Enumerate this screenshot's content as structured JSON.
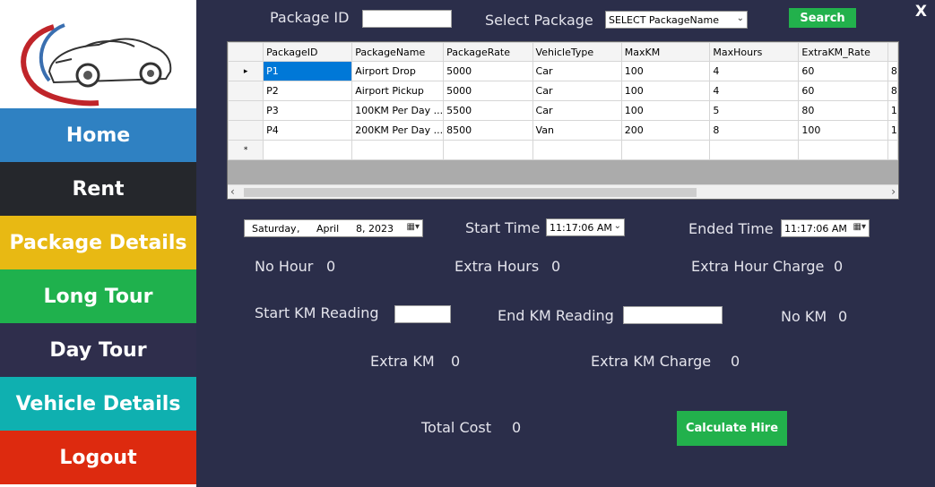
{
  "sidebar": {
    "items": [
      {
        "label": "Home",
        "color": "#2f81c2"
      },
      {
        "label": "Rent",
        "color": "#25272c"
      },
      {
        "label": "Package Details",
        "color": "#e8b913"
      },
      {
        "label": "Long Tour",
        "color": "#1fb14d"
      },
      {
        "label": "Day Tour",
        "color": "#2f2e4c"
      },
      {
        "label": "Vehicle Details",
        "color": "#0fb0b0"
      },
      {
        "label": "Logout",
        "color": "#dd2a0f"
      }
    ]
  },
  "search": {
    "package_id_label": "Package ID",
    "package_id_value": "",
    "select_package_label": "Select Package",
    "select_package_value": "SELECT PackageName",
    "search_button": "Search"
  },
  "grid": {
    "columns": [
      "PackageID",
      "PackageName",
      "PackageRate",
      "VehicleType",
      "MaxKM",
      "MaxHours",
      "ExtraKM_Rate",
      ""
    ],
    "rows": [
      [
        "P1",
        "Airport Drop",
        "5000",
        "Car",
        "100",
        "4",
        "60",
        "8"
      ],
      [
        "P2",
        "Airport Pickup",
        "5000",
        "Car",
        "100",
        "4",
        "60",
        "8"
      ],
      [
        "P3",
        "100KM Per Day ...",
        "5500",
        "Car",
        "100",
        "5",
        "80",
        "1"
      ],
      [
        "P4",
        "200KM Per Day ...",
        "8500",
        "Van",
        "200",
        "8",
        "100",
        "1"
      ]
    ],
    "new_row_marker": "*",
    "current_row_marker": "▸"
  },
  "form": {
    "date": {
      "day": "Saturday",
      "month": "April",
      "date": "8, 2023"
    },
    "start_time_label": "Start Time",
    "start_time_value": "11:17:06 AM",
    "ended_time_label": "Ended Time",
    "ended_time_value": "11:17:06 AM",
    "no_hour_label": "No Hour",
    "no_hour_value": "0",
    "extra_hours_label": "Extra Hours",
    "extra_hours_value": "0",
    "extra_hour_charge_label": "Extra Hour Charge",
    "extra_hour_charge_value": "0",
    "start_km_label": "Start KM Reading",
    "start_km_value": "",
    "end_km_label": "End KM Reading",
    "end_km_value": "",
    "no_km_label": "No KM",
    "no_km_value": "0",
    "extra_km_label": "Extra KM",
    "extra_km_value": "0",
    "extra_km_charge_label": "Extra KM Charge",
    "extra_km_charge_value": "0",
    "total_cost_label": "Total Cost",
    "total_cost_value": "0",
    "calculate_button": "Calculate Hire"
  },
  "window": {
    "close_label": "X"
  }
}
